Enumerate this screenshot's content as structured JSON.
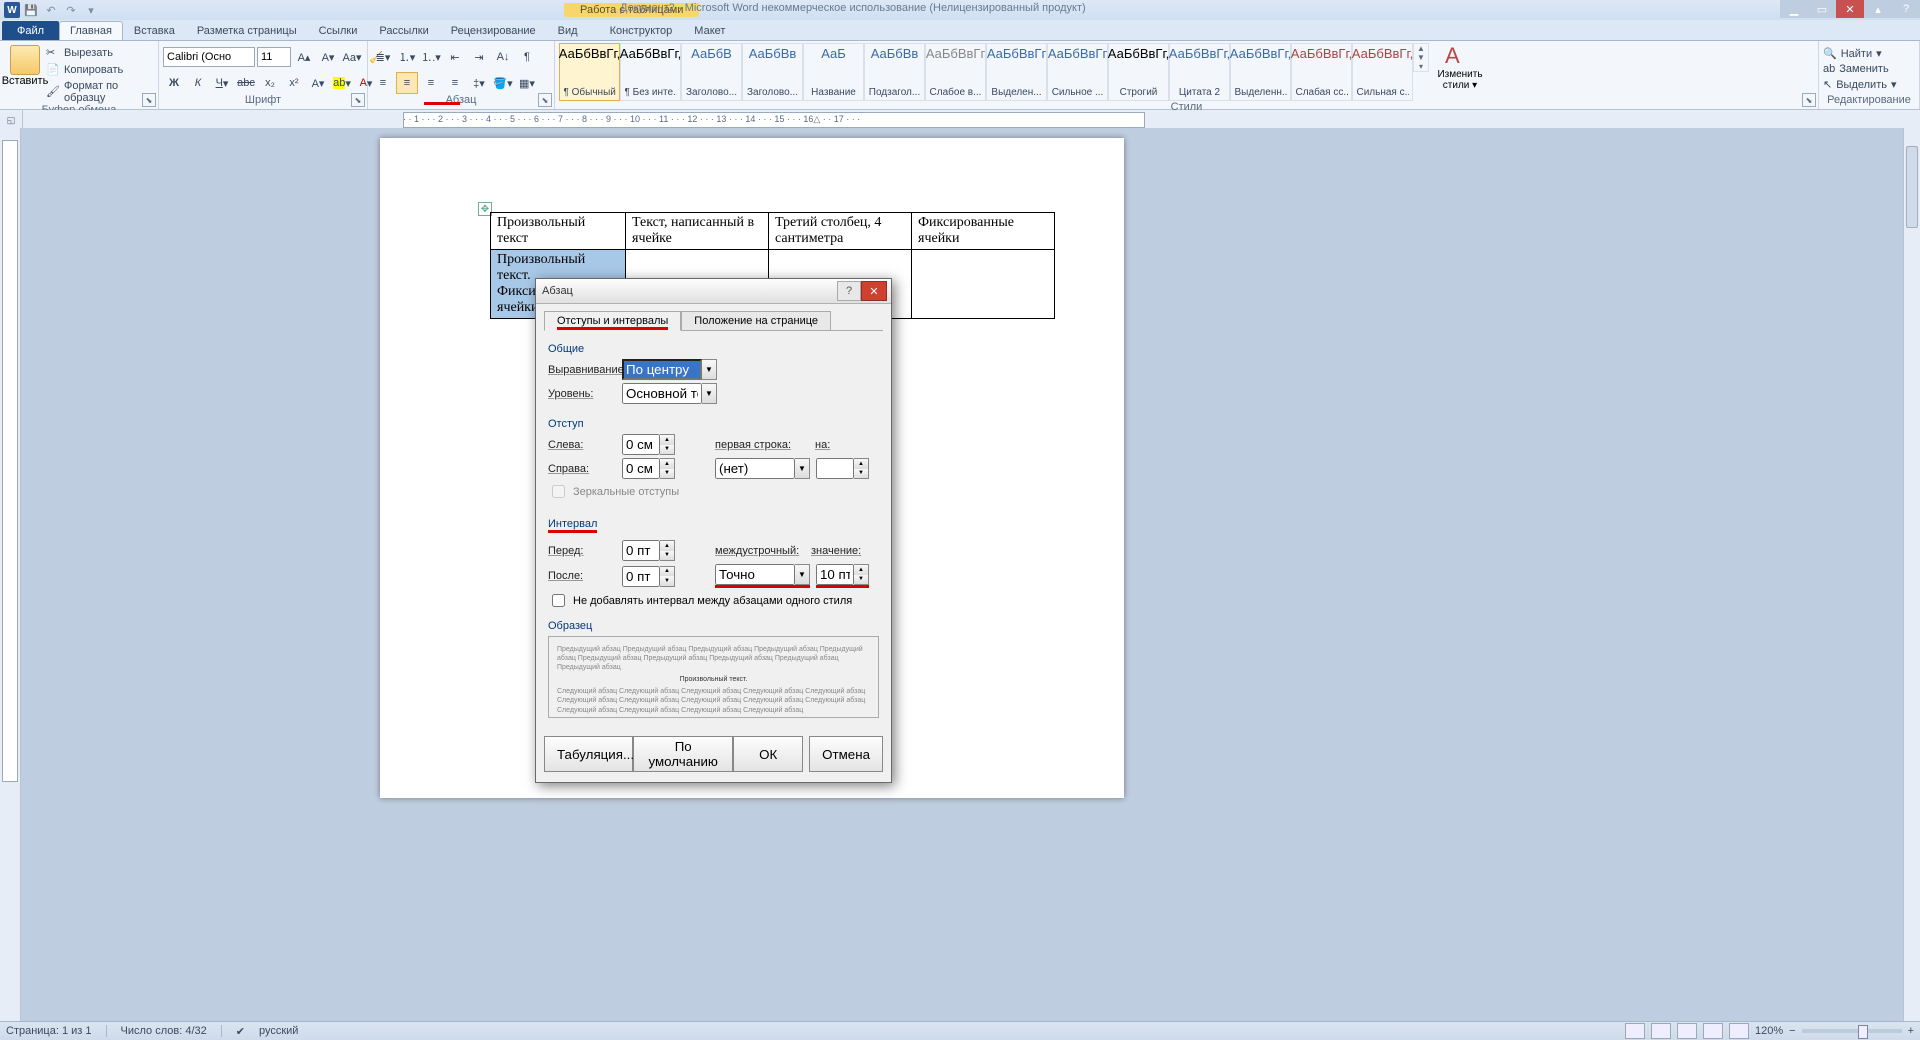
{
  "titlebar": {
    "context_label": "Работа с таблицами",
    "doc_title": "Документ2 - Microsoft Word некоммерческое использование (Нелицензированный продукт)"
  },
  "tabs": {
    "file": "Файл",
    "home": "Главная",
    "insert": "Вставка",
    "layout": "Разметка страницы",
    "refs": "Ссылки",
    "mail": "Рассылки",
    "review": "Рецензирование",
    "view": "Вид",
    "design": "Конструктор",
    "tlayout": "Макет"
  },
  "ribbon": {
    "clipboard": {
      "label": "Буфер обмена",
      "paste": "Вставить",
      "cut": "Вырезать",
      "copy": "Копировать",
      "painter": "Формат по образцу"
    },
    "font": {
      "label": "Шрифт",
      "name": "Calibri (Осно",
      "size": "11"
    },
    "para": {
      "label": "Абзац"
    },
    "styles": {
      "label": "Стили",
      "items": [
        {
          "p": "АаБбВвГг,",
          "n": "¶ Обычный"
        },
        {
          "p": "АаБбВвГг,",
          "n": "¶ Без инте..."
        },
        {
          "p": "АаБбВ",
          "n": "Заголово..."
        },
        {
          "p": "АаБбВв",
          "n": "Заголово..."
        },
        {
          "p": "АаБ",
          "n": "Название"
        },
        {
          "p": "АаБбВв",
          "n": "Подзагол..."
        },
        {
          "p": "АаБбВвГг",
          "n": "Слабое в..."
        },
        {
          "p": "АаБбВвГг",
          "n": "Выделен..."
        },
        {
          "p": "АаБбВвГг",
          "n": "Сильное ..."
        },
        {
          "p": "АаБбВвГг,",
          "n": "Строгий"
        },
        {
          "p": "АаБбВвГг,",
          "n": "Цитата 2"
        },
        {
          "p": "АаБбВвГг,",
          "n": "Выделенн..."
        },
        {
          "p": "АаБбВвГг,",
          "n": "Слабая сс..."
        },
        {
          "p": "АаБбВвГг,",
          "n": "Сильная с..."
        }
      ],
      "change": "Изменить стили"
    },
    "editing": {
      "label": "Редактирование",
      "find": "Найти",
      "replace": "Заменить",
      "select": "Выделить"
    }
  },
  "table": {
    "r1c1": "Произвольный текст",
    "r1c2": "Текст, написанный в ячейке",
    "r1c3": "Третий столбец, 4 сантиметра",
    "r1c4": "Фиксированные ячейки",
    "r2c1": "Произвольный текст. Фиксированные ячейки"
  },
  "dialog": {
    "title": "Абзац",
    "tab1": "Отступы и интервалы",
    "tab2": "Положение на странице",
    "sect_general": "Общие",
    "align_lbl": "Выравнивание:",
    "align_val": "По центру",
    "level_lbl": "Уровень:",
    "level_val": "Основной текст",
    "sect_indent": "Отступ",
    "left_lbl": "Слева:",
    "left_val": "0 см",
    "right_lbl": "Справа:",
    "right_val": "0 см",
    "first_lbl": "первая строка:",
    "first_val": "(нет)",
    "by_lbl": "на:",
    "mirror": "Зеркальные отступы",
    "sect_spacing": "Интервал",
    "before_lbl": "Перед:",
    "before_val": "0 пт",
    "after_lbl": "После:",
    "after_val": "0 пт",
    "line_lbl": "междустрочный:",
    "line_val": "Точно",
    "line_at_lbl": "значение:",
    "line_at_val": "10 пт",
    "nosame": "Не добавлять интервал между абзацами одного стиля",
    "sect_preview": "Образец",
    "preview_text1": "Предыдущий абзац Предыдущий абзац Предыдущий абзац Предыдущий абзац Предыдущий абзац Предыдущий абзац Предыдущий абзац Предыдущий абзац Предыдущий абзац Предыдущий абзац",
    "preview_center": "Произвольный текст.",
    "preview_text2": "Следующий абзац Следующий абзац Следующий абзац Следующий абзац Следующий абзац Следующий абзац Следующий абзац Следующий абзац Следующий абзац Следующий абзац Следующий абзац Следующий абзац Следующий абзац Следующий абзац",
    "btn_tabs": "Табуляция...",
    "btn_default": "По умолчанию",
    "btn_ok": "ОК",
    "btn_cancel": "Отмена"
  },
  "status": {
    "page": "Страница: 1 из 1",
    "words": "Число слов: 4/32",
    "lang": "русский",
    "zoom": "120%"
  },
  "ruler_ticks": "· · 1 · · · 2 · · · 3 · · · 4 · · · 5 · · · 6 · · · 7 · · · 8 · · · 9 · · · 10 · · · 11 · · · 12 · · · 13 · · · 14 · · · 15 · · · 16△ · · 17 · · ·"
}
